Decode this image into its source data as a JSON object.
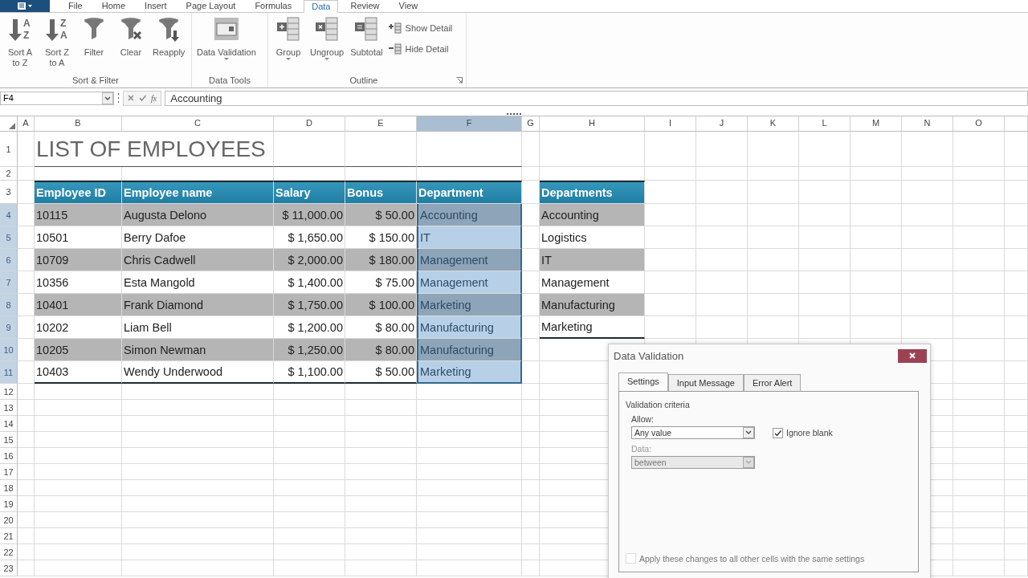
{
  "ribbon_tabs": [
    {
      "label": "File",
      "selected": false
    },
    {
      "label": "Home",
      "selected": false
    },
    {
      "label": "Insert",
      "selected": false
    },
    {
      "label": "Page Layout",
      "selected": false
    },
    {
      "label": "Formulas",
      "selected": false
    },
    {
      "label": "Data",
      "selected": true
    },
    {
      "label": "Review",
      "selected": false
    },
    {
      "label": "View",
      "selected": false
    }
  ],
  "ribbon_groups": [
    {
      "label": "Sort & Filter",
      "launcher": false,
      "buttons": [
        {
          "kind": "sort",
          "label": "Sort A\nto Z",
          "icon_letters": "AZ",
          "dropdown": false
        },
        {
          "kind": "sort",
          "label": "Sort Z\nto A",
          "icon_letters": "ZA",
          "dropdown": false
        },
        {
          "kind": "filter",
          "label": "Filter",
          "dropdown": false
        },
        {
          "kind": "clear",
          "label": "Clear",
          "dropdown": false
        },
        {
          "kind": "reapply",
          "label": "Reapply",
          "dropdown": false
        }
      ]
    },
    {
      "label": "Data Tools",
      "launcher": false,
      "buttons": [
        {
          "kind": "validation",
          "label": "Data Validation",
          "dropdown": true
        }
      ]
    },
    {
      "label": "Outline",
      "launcher": true,
      "buttons": [
        {
          "kind": "group",
          "label": "Group",
          "dropdown": true
        },
        {
          "kind": "ungroup",
          "label": "Ungroup",
          "dropdown": true
        },
        {
          "kind": "subtotal",
          "label": "Subtotal",
          "dropdown": false
        },
        {
          "kind": "show-detail",
          "label": "Show Detail"
        },
        {
          "kind": "hide-detail",
          "label": "Hide Detail"
        }
      ]
    }
  ],
  "formula_bar": {
    "name_box": "F4",
    "function_button": "fx",
    "value": "Accounting"
  },
  "column_headers": [
    {
      "label": "A",
      "selected": false
    },
    {
      "label": "B",
      "selected": false
    },
    {
      "label": "C",
      "selected": false
    },
    {
      "label": "D",
      "selected": false
    },
    {
      "label": "E",
      "selected": false
    },
    {
      "label": "F",
      "selected": true
    },
    {
      "label": "G",
      "selected": false
    },
    {
      "label": "H",
      "selected": false
    },
    {
      "label": "I",
      "selected": false
    },
    {
      "label": "J",
      "selected": false
    },
    {
      "label": "K",
      "selected": false
    },
    {
      "label": "L",
      "selected": false
    },
    {
      "label": "M",
      "selected": false
    },
    {
      "label": "N",
      "selected": false
    },
    {
      "label": "O",
      "selected": false
    }
  ],
  "row_headers": [
    {
      "label": "1",
      "selected": false
    },
    {
      "label": "2",
      "selected": false
    },
    {
      "label": "3",
      "selected": false
    },
    {
      "label": "4",
      "selected": true
    },
    {
      "label": "5",
      "selected": true
    },
    {
      "label": "6",
      "selected": true
    },
    {
      "label": "7",
      "selected": true
    },
    {
      "label": "8",
      "selected": true
    },
    {
      "label": "9",
      "selected": true
    },
    {
      "label": "10",
      "selected": true
    },
    {
      "label": "11",
      "selected": true
    },
    {
      "label": "12",
      "selected": false
    },
    {
      "label": "13",
      "selected": false
    },
    {
      "label": "14",
      "selected": false
    },
    {
      "label": "15",
      "selected": false
    },
    {
      "label": "16",
      "selected": false
    },
    {
      "label": "17",
      "selected": false
    },
    {
      "label": "18",
      "selected": false
    },
    {
      "label": "19",
      "selected": false
    },
    {
      "label": "20",
      "selected": false
    },
    {
      "label": "21",
      "selected": false
    },
    {
      "label": "22",
      "selected": false
    },
    {
      "label": "23",
      "selected": false
    }
  ],
  "title": "LIST OF EMPLOYEES",
  "employee_table": {
    "columns": [
      "Employee ID",
      "Employee name",
      "Salary",
      "Bonus",
      "Department"
    ],
    "rows": [
      [
        "10115",
        "Augusta Delono",
        "$ 11,000.00",
        "$ 50.00",
        "Accounting"
      ],
      [
        "10501",
        "Berry Dafoe",
        "$ 1,650.00",
        "$ 150.00",
        "IT"
      ],
      [
        "10709",
        "Chris Cadwell",
        "$ 2,000.00",
        "$ 180.00",
        "Management"
      ],
      [
        "10356",
        "Esta Mangold",
        "$ 1,400.00",
        "$ 75.00",
        "Management"
      ],
      [
        "10401",
        "Frank Diamond",
        "$ 1,750.00",
        "$ 100.00",
        "Marketing"
      ],
      [
        "10202",
        "Liam Bell",
        "$ 1,200.00",
        "$ 80.00",
        "Manufacturing"
      ],
      [
        "10205",
        "Simon Newman",
        "$ 1,250.00",
        "$ 80.00",
        "Manufacturing"
      ],
      [
        "10403",
        "Wendy Underwood",
        "$ 1,100.00",
        "$ 50.00",
        "Marketing"
      ]
    ]
  },
  "departments": {
    "header": "Departments",
    "items": [
      "Accounting",
      "Logistics",
      "IT",
      "Management",
      "Manufacturing",
      "Marketing"
    ]
  },
  "dialog": {
    "title": "Data Validation",
    "tabs": [
      {
        "label": "Settings",
        "selected": true
      },
      {
        "label": "Input Message",
        "selected": false
      },
      {
        "label": "Error Alert",
        "selected": false
      }
    ],
    "section": "Validation criteria",
    "allow": {
      "label": "Allow:",
      "value": "Any value",
      "disabled": false
    },
    "ignore_blank": {
      "label": "Ignore blank",
      "checked": true
    },
    "data": {
      "label": "Data:",
      "value": "between",
      "disabled": true
    },
    "apply_all": {
      "label": "Apply these changes to all other cells with the same settings",
      "checked": false,
      "disabled": true
    }
  }
}
